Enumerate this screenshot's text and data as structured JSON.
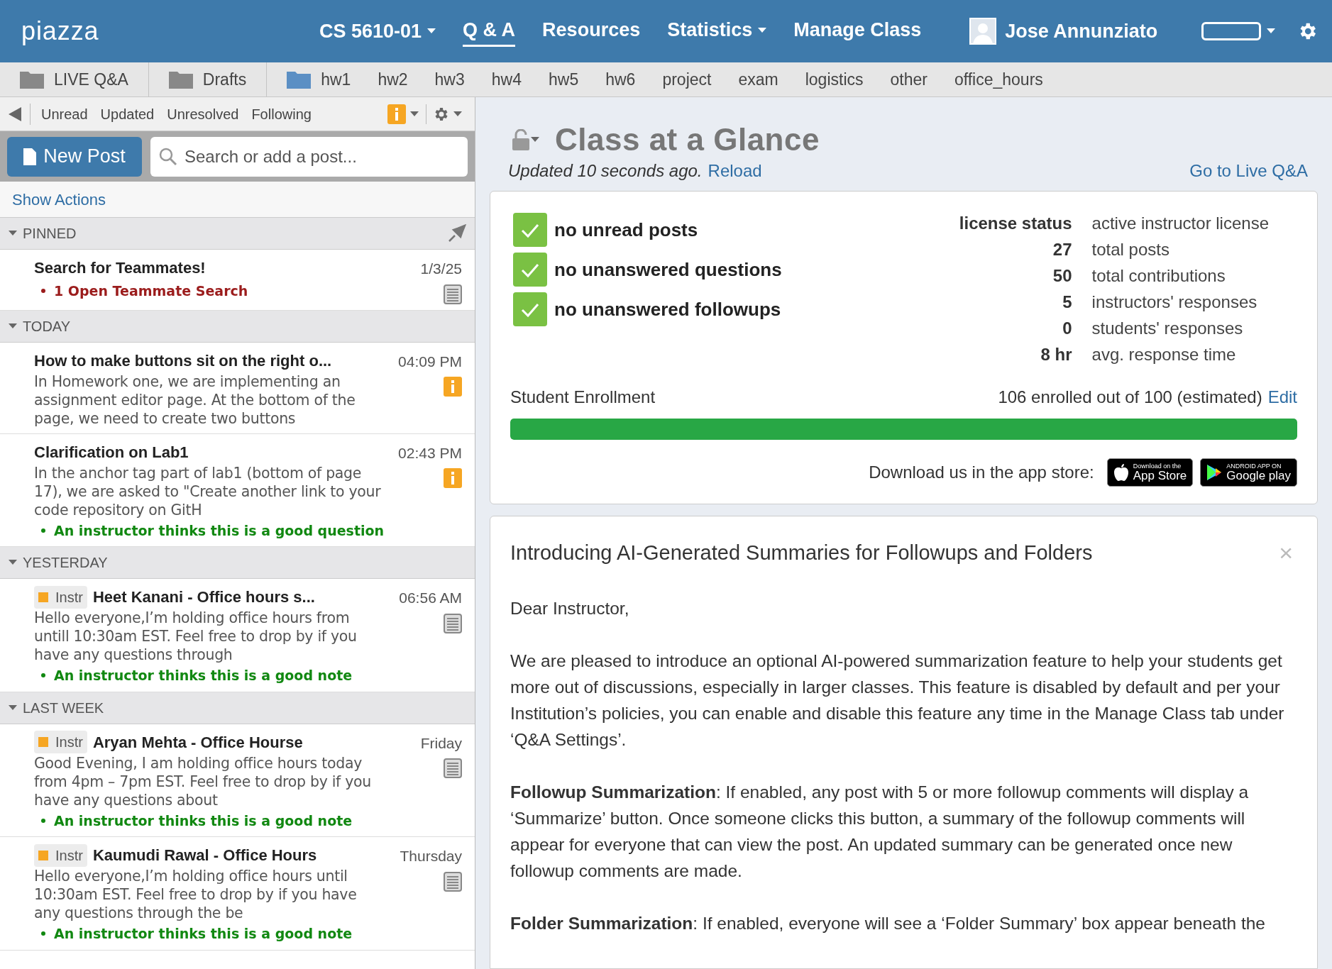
{
  "nav": {
    "logo": "piazza",
    "course": "CS 5610-01",
    "items": [
      {
        "label": "Q & A",
        "selected": true,
        "dropdown": false
      },
      {
        "label": "Resources",
        "selected": false,
        "dropdown": false
      },
      {
        "label": "Statistics",
        "selected": false,
        "dropdown": true
      },
      {
        "label": "Manage Class",
        "selected": false,
        "dropdown": false
      }
    ],
    "user": "Jose Annunziato"
  },
  "folders": [
    {
      "label": "LIVE Q&A",
      "kind": "special"
    },
    {
      "label": "Drafts",
      "kind": "special"
    },
    {
      "label": "hw1",
      "kind": "folder"
    },
    {
      "label": "hw2",
      "kind": "tag"
    },
    {
      "label": "hw3",
      "kind": "tag"
    },
    {
      "label": "hw4",
      "kind": "tag"
    },
    {
      "label": "hw5",
      "kind": "tag"
    },
    {
      "label": "hw6",
      "kind": "tag"
    },
    {
      "label": "project",
      "kind": "tag"
    },
    {
      "label": "exam",
      "kind": "tag"
    },
    {
      "label": "logistics",
      "kind": "tag"
    },
    {
      "label": "other",
      "kind": "tag"
    },
    {
      "label": "office_hours",
      "kind": "tag"
    }
  ],
  "filters": [
    "Unread",
    "Updated",
    "Unresolved",
    "Following"
  ],
  "new_post": "New Post",
  "search": {
    "placeholder": "Search or add a post..."
  },
  "show_actions": "Show Actions",
  "groups": [
    {
      "label": "PINNED",
      "pinned": true,
      "posts": [
        {
          "title": "Search for Teammates!",
          "date": "1/3/25",
          "kind": "note",
          "note": "1 Open Teammate Search",
          "color": "#9b1c1c"
        }
      ]
    },
    {
      "label": "TODAY",
      "pinned": false,
      "posts": [
        {
          "title": "How to make buttons sit on the right o...",
          "date": "04:09 PM",
          "kind": "question",
          "snippet": "In Homework one, we are implementing an assignment editor page. At the bottom of the page, we need to create two buttons"
        },
        {
          "title": "Clarification on Lab1",
          "date": "02:43 PM",
          "kind": "question",
          "snippet": "In the anchor tag part of lab1 (bottom of page 17), we are asked to \"Create another link to your code repository on GitH",
          "note": "An instructor thinks this is a good question",
          "color": "#118811"
        }
      ]
    },
    {
      "label": "YESTERDAY",
      "pinned": false,
      "posts": [
        {
          "badge": "Instr",
          "title": "Heet Kanani - Office hours s...",
          "date": "06:56 AM",
          "kind": "note",
          "snippet": "Hello everyone,I’m holding office hours from untill 10:30am EST. Feel free to drop by if you have any questions through",
          "note": "An instructor thinks this is a good note",
          "color": "#118811"
        }
      ]
    },
    {
      "label": "LAST WEEK",
      "pinned": false,
      "posts": [
        {
          "badge": "Instr",
          "title": "Aryan Mehta - Office Hourse",
          "date": "Friday",
          "kind": "note",
          "snippet": "Good Evening, I am holding office hours today from 4pm – 7pm EST. Feel free to drop by if you have any questions about",
          "note": "An instructor thinks this is a good note",
          "color": "#118811"
        },
        {
          "badge": "Instr",
          "title": "Kaumudi Rawal - Office Hours",
          "date": "Thursday",
          "kind": "note",
          "snippet": "Hello everyone,I’m holding office hours until 10:30am EST. Feel free to drop by if you have any questions through the be",
          "note": "An instructor thinks this is a good note",
          "color": "#118811"
        }
      ]
    }
  ],
  "glance": {
    "title": "Class at a Glance",
    "updated": "Updated 10 seconds ago.",
    "reload": "Reload",
    "live_link": "Go to Live Q&A",
    "checks": [
      {
        "label": "no unread posts",
        "checked": true
      },
      {
        "label": "no unanswered questions",
        "checked": true
      },
      {
        "label": "no unanswered followups",
        "checked": true
      }
    ],
    "stats": [
      {
        "value": "license status",
        "label": "active instructor license"
      },
      {
        "value": "27",
        "label": "total posts"
      },
      {
        "value": "50",
        "label": "total contributions"
      },
      {
        "value": "5",
        "label": "instructors' responses"
      },
      {
        "value": "0",
        "label": "students' responses"
      },
      {
        "value": "8 hr",
        "label": "avg. response time"
      }
    ],
    "enrollment": {
      "label": "Student Enrollment",
      "count": "106 enrolled out of 100 (estimated)",
      "edit": "Edit",
      "level": 1
    },
    "app_text": "Download us in the app store:",
    "badges": [
      {
        "kind": "apple",
        "small": "Download on the",
        "big": "App Store"
      },
      {
        "kind": "google",
        "small": "ANDROID APP ON",
        "big": "Google play"
      }
    ]
  },
  "announcement": {
    "title": "Introducing AI-Generated Summaries for Followups and Folders",
    "close": "×",
    "paragraphs": [
      "Dear Instructor,",
      "We are pleased to introduce an optional AI-powered summarization feature to help your students get more out of discussions, especially in larger classes. This feature is disabled by default and per your Institution’s policies, you can enable and disable this feature any time in the Manage Class tab under ‘Q&A Settings’.",
      "**Followup Summarization**: If enabled, any post with 5 or more followup comments will display a ‘Summarize’ button. Once someone clicks this button, a summary of the followup comments will appear for everyone that can view the post. An updated summary can be generated once new followup comments are made.",
      "**Folder Summarization**: If enabled, everyone will see a ‘Folder Summary’ box appear beneath the"
    ]
  }
}
